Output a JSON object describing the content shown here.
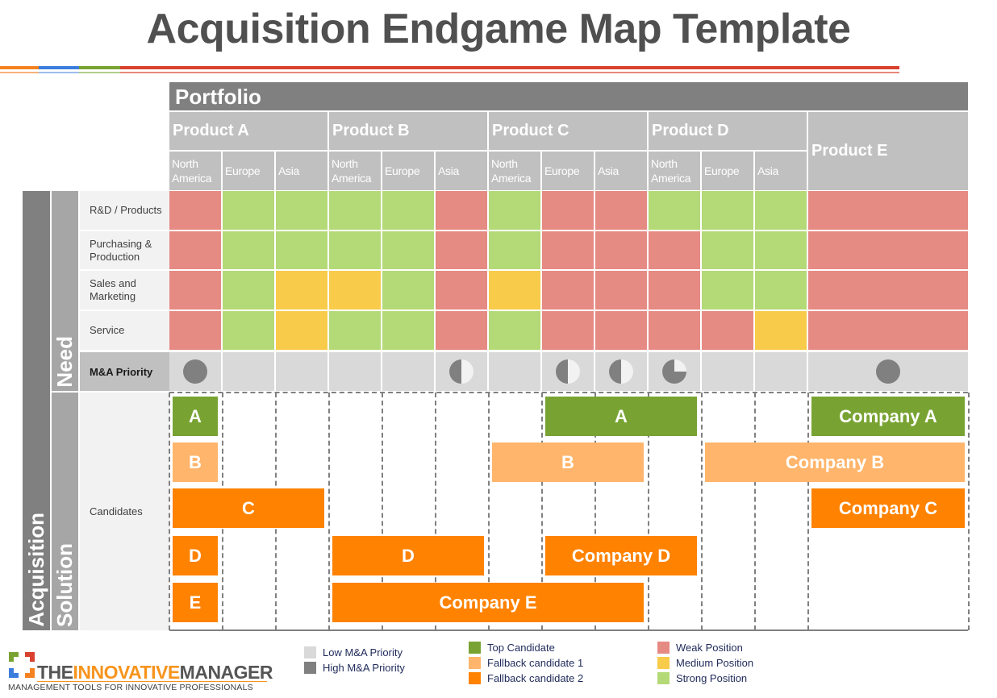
{
  "title": "Acquisition Endgame Map Template",
  "portfolio_label": "Portfolio",
  "products": [
    {
      "name": "Product A",
      "regions": [
        "North America",
        "Europe",
        "Asia"
      ]
    },
    {
      "name": "Product B",
      "regions": [
        "North America",
        "Europe",
        "Asia"
      ]
    },
    {
      "name": "Product C",
      "regions": [
        "North America",
        "Europe",
        "Asia"
      ]
    },
    {
      "name": "Product D",
      "regions": [
        "North America",
        "Europe",
        "Asia"
      ]
    },
    {
      "name": "Product E",
      "regions": []
    }
  ],
  "side_labels": {
    "acquisition": "Acquisition",
    "need": "Need",
    "solution": "Solution"
  },
  "need_rows": [
    {
      "label": "R&D / Products",
      "values": [
        "weak",
        "strong",
        "strong",
        "strong",
        "strong",
        "weak",
        "strong",
        "weak",
        "weak",
        "strong",
        "strong",
        "strong",
        "weak"
      ]
    },
    {
      "label": "Purchasing & Production",
      "values": [
        "weak",
        "strong",
        "strong",
        "strong",
        "strong",
        "weak",
        "strong",
        "weak",
        "weak",
        "weak",
        "strong",
        "strong",
        "weak"
      ]
    },
    {
      "label": "Sales and Marketing",
      "values": [
        "weak",
        "strong",
        "medium",
        "medium",
        "strong",
        "weak",
        "medium",
        "weak",
        "weak",
        "weak",
        "strong",
        "strong",
        "weak"
      ]
    },
    {
      "label": "Service",
      "values": [
        "weak",
        "strong",
        "medium",
        "strong",
        "strong",
        "weak",
        "strong",
        "weak",
        "weak",
        "weak",
        "weak",
        "medium",
        "weak"
      ]
    }
  ],
  "ma_priority": {
    "label": "M&A Priority",
    "values": [
      1,
      0,
      0,
      0,
      0,
      0.5,
      0,
      0.5,
      0.5,
      0.75,
      0,
      0,
      1
    ]
  },
  "candidates_label": "Candidates",
  "candidates": [
    {
      "label": "A",
      "type": "top",
      "row": 0,
      "start": 0,
      "end": 0
    },
    {
      "label": "A",
      "type": "top",
      "row": 0,
      "start": 7,
      "end": 9
    },
    {
      "label": "Company A",
      "type": "top",
      "row": 0,
      "start": 12,
      "end": 12
    },
    {
      "label": "B",
      "type": "fallback1",
      "row": 1,
      "start": 0,
      "end": 0
    },
    {
      "label": "B",
      "type": "fallback1",
      "row": 1,
      "start": 6,
      "end": 8
    },
    {
      "label": "Company B",
      "type": "fallback1",
      "row": 1,
      "start": 10,
      "end": 12
    },
    {
      "label": "C",
      "type": "fallback2",
      "row": 2,
      "start": 0,
      "end": 2
    },
    {
      "label": "Company C",
      "type": "fallback2",
      "row": 2,
      "start": 12,
      "end": 12
    },
    {
      "label": "D",
      "type": "fallback2",
      "row": 3,
      "start": 0,
      "end": 0
    },
    {
      "label": "D",
      "type": "fallback2",
      "row": 3,
      "start": 3,
      "end": 5
    },
    {
      "label": "Company D",
      "type": "fallback2",
      "row": 3,
      "start": 7,
      "end": 9
    },
    {
      "label": "E",
      "type": "fallback2",
      "row": 4,
      "start": 0,
      "end": 0
    },
    {
      "label": "Company E",
      "type": "fallback2",
      "row": 4,
      "start": 3,
      "end": 8
    }
  ],
  "colors": {
    "weak": "#e68a84",
    "medium": "#f8cb4a",
    "strong": "#b4d977",
    "top": "#78a332",
    "fallback1": "#ffb56b",
    "fallback2": "#ff8200",
    "low_priority": "#d9d9d9",
    "high_priority": "#808080"
  },
  "legend": {
    "priority": [
      {
        "label": "Low M&A Priority",
        "color_key": "low_priority"
      },
      {
        "label": "High M&A Priority",
        "color_key": "high_priority"
      }
    ],
    "candidates": [
      {
        "label": "Top Candidate",
        "color_key": "top"
      },
      {
        "label": "Fallback candidate 1",
        "color_key": "fallback1"
      },
      {
        "label": "Fallback candidate 2",
        "color_key": "fallback2"
      }
    ],
    "position": [
      {
        "label": "Weak Position",
        "color_key": "weak"
      },
      {
        "label": "Medium Position",
        "color_key": "medium"
      },
      {
        "label": "Strong Position",
        "color_key": "strong"
      }
    ]
  },
  "logo": {
    "part1": "THE",
    "part2": "INNOVATIVE",
    "part3": "MANAGER",
    "tagline": "MANAGEMENT TOOLS FOR INNOVATIVE PROFESSIONALS"
  }
}
